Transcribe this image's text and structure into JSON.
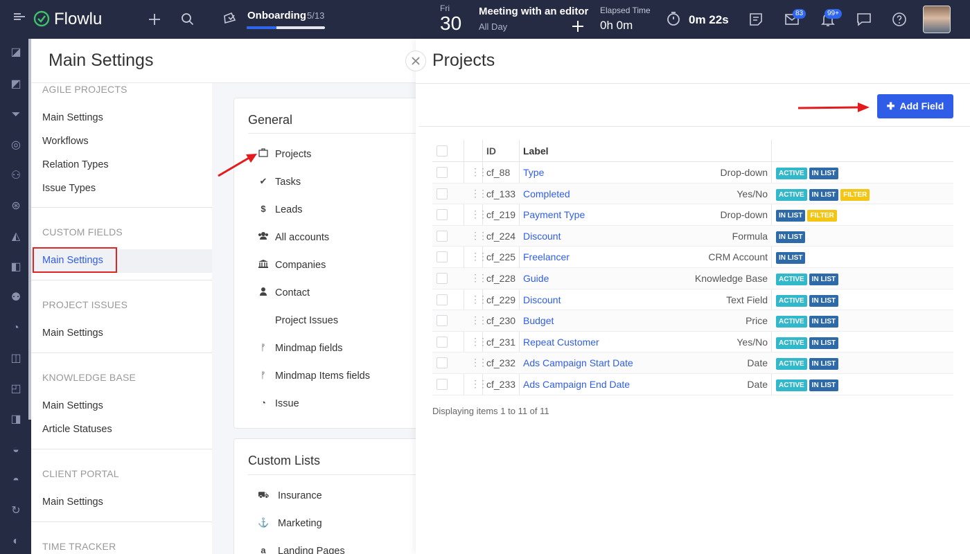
{
  "topbar": {
    "logo": "Flowlu",
    "onboarding": {
      "title": "Onboarding",
      "count": "5/13",
      "progress": 0.38
    },
    "date": {
      "dow": "Fri",
      "day": "30"
    },
    "event": {
      "title": "Meeting with an editor",
      "sub": "All Day"
    },
    "elapsed": {
      "label": "Elapsed Time",
      "value": "0h 0m"
    },
    "timer": "0m 22s",
    "mail_badge": "83",
    "notif_badge": "99+"
  },
  "settings": {
    "title": "Main Settings",
    "nav": {
      "agile_h": "AGILE PROJECTS",
      "agile_items": [
        "Main Settings",
        "Workflows",
        "Relation Types",
        "Issue Types"
      ],
      "custom_h": "CUSTOM FIELDS",
      "custom_item": "Main Settings",
      "issues_h": "PROJECT ISSUES",
      "issues_item": "Main Settings",
      "kb_h": "KNOWLEDGE BASE",
      "kb_items": [
        "Main Settings",
        "Article Statuses"
      ],
      "portal_h": "CLIENT PORTAL",
      "portal_item": "Main Settings",
      "time_h": "TIME TRACKER"
    },
    "general": {
      "title": "General",
      "items": [
        "Projects",
        "Tasks",
        "Leads",
        "All accounts",
        "Companies",
        "Contact",
        "Project Issues",
        "Mindmap fields",
        "Mindmap Items fields",
        "Issue"
      ]
    },
    "custom_lists": {
      "title": "Custom Lists",
      "items": [
        "Insurance",
        "Marketing",
        "Landing Pages"
      ]
    }
  },
  "projects": {
    "title": "Projects",
    "add_button": "Add Field",
    "columns": {
      "id": "ID",
      "label": "Label"
    },
    "rows": [
      {
        "id": "cf_88",
        "label": "Type",
        "type": "Drop-down",
        "tags": [
          "ACTIVE",
          "IN LIST"
        ]
      },
      {
        "id": "cf_133",
        "label": "Completed",
        "type": "Yes/No",
        "tags": [
          "ACTIVE",
          "IN LIST",
          "FILTER"
        ]
      },
      {
        "id": "cf_219",
        "label": "Payment Type",
        "type": "Drop-down",
        "tags": [
          "IN LIST",
          "FILTER"
        ]
      },
      {
        "id": "cf_224",
        "label": "Discount",
        "type": "Formula",
        "tags": [
          "IN LIST"
        ]
      },
      {
        "id": "cf_225",
        "label": "Freelancer",
        "type": "CRM Account",
        "tags": [
          "IN LIST"
        ]
      },
      {
        "id": "cf_228",
        "label": "Guide",
        "type": "Knowledge Base",
        "tags": [
          "ACTIVE",
          "IN LIST"
        ]
      },
      {
        "id": "cf_229",
        "label": "Discount",
        "type": "Text Field",
        "tags": [
          "ACTIVE",
          "IN LIST"
        ]
      },
      {
        "id": "cf_230",
        "label": "Budget",
        "type": "Price",
        "tags": [
          "ACTIVE",
          "IN LIST"
        ]
      },
      {
        "id": "cf_231",
        "label": "Repeat Customer",
        "type": "Yes/No",
        "tags": [
          "ACTIVE",
          "IN LIST"
        ]
      },
      {
        "id": "cf_232",
        "label": "Ads Campaign Start Date",
        "type": "Date",
        "tags": [
          "ACTIVE",
          "IN LIST"
        ]
      },
      {
        "id": "cf_233",
        "label": "Ads Campaign End Date",
        "type": "Date",
        "tags": [
          "ACTIVE",
          "IN LIST"
        ]
      }
    ],
    "footer": "Displaying items 1 to 11 of 11"
  },
  "colors": {
    "active": "#31b8cb",
    "inlist": "#2e6aa7",
    "filter": "#f3c515",
    "accent": "#2f5de8",
    "topbar": "#262b44"
  }
}
